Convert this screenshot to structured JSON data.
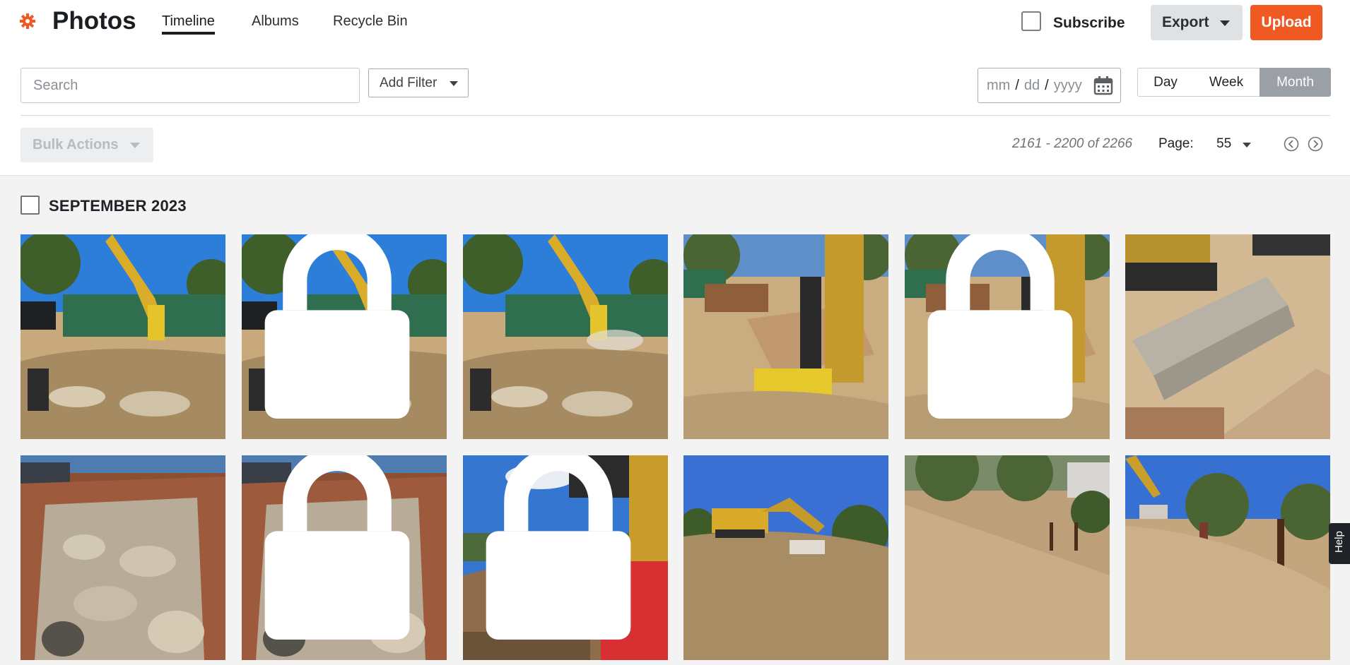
{
  "app": {
    "title": "Photos",
    "accent": "#f05a22"
  },
  "nav": {
    "tabs": [
      "Timeline",
      "Albums",
      "Recycle Bin"
    ],
    "active_tab": "Timeline"
  },
  "header": {
    "subscribe_label": "Subscribe",
    "export_label": "Export",
    "upload_label": "Upload"
  },
  "search": {
    "placeholder": "Search",
    "add_filter_label": "Add Filter"
  },
  "date_picker": {
    "mm": "mm",
    "dd": "dd",
    "yyyy": "yyyy",
    "separator": "/"
  },
  "view_toggle": {
    "options": [
      "Day",
      "Week",
      "Month"
    ],
    "selected": "Month"
  },
  "toolbar": {
    "bulk_actions_label": "Bulk Actions"
  },
  "pagination": {
    "range_text": "2161 - 2200 of 2266",
    "page_label": "Page:",
    "page_value": "55"
  },
  "gallery": {
    "month_label": "SEPTEMBER 2023",
    "photos": [
      {
        "scene": "excavator-breaker-dumpster",
        "locked": false
      },
      {
        "scene": "excavator-breaker-dumpster",
        "locked": true
      },
      {
        "scene": "excavator-breaker-dumpster",
        "locked": false
      },
      {
        "scene": "worker-breaker-lumber",
        "locked": false
      },
      {
        "scene": "worker-breaker-lumber",
        "locked": true
      },
      {
        "scene": "excavator-concrete-footing",
        "locked": false
      },
      {
        "scene": "dumpster-concrete-rubble",
        "locked": false
      },
      {
        "scene": "dumpster-concrete-rubble",
        "locked": true
      },
      {
        "scene": "breaker-red-truck",
        "locked": true
      },
      {
        "scene": "excavator-on-slope",
        "locked": false
      },
      {
        "scene": "graded-dirt-slope",
        "locked": false
      },
      {
        "scene": "slope-with-worker",
        "locked": false
      }
    ]
  },
  "help": {
    "label": "Help"
  }
}
